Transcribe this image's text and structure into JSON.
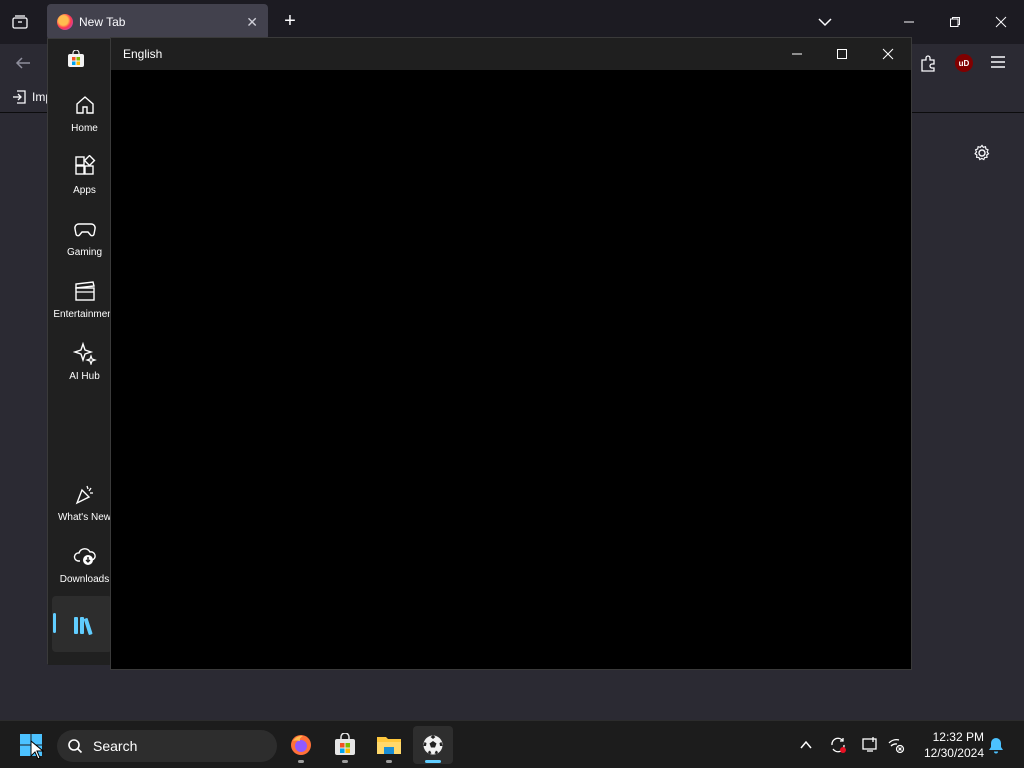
{
  "firefox": {
    "tab_title": "New Tab",
    "bookmarks_import_label": "Imp"
  },
  "store": {
    "nav": [
      {
        "label": "Home",
        "icon": "home-icon"
      },
      {
        "label": "Apps",
        "icon": "apps-icon"
      },
      {
        "label": "Gaming",
        "icon": "gamepad-icon"
      },
      {
        "label": "Entertainment",
        "icon": "clapperboard-icon"
      },
      {
        "label": "AI Hub",
        "icon": "sparkle-icon"
      }
    ],
    "nav_bottom": [
      {
        "label": "What's New",
        "icon": "party-popper-icon"
      },
      {
        "label": "Downloads",
        "icon": "cloud-download-icon"
      }
    ],
    "library_icon": "library-icon"
  },
  "english_window": {
    "title": "English"
  },
  "taskbar": {
    "search_placeholder": "Search",
    "time": "12:32 PM",
    "date": "12/30/2024",
    "apps": [
      "firefox-icon",
      "store-icon",
      "file-explorer-icon",
      "soccer-ball-icon"
    ]
  },
  "colors": {
    "accent": "#60cdff",
    "store_bg": "#202020",
    "firefox_bg": "#2b2a33"
  }
}
